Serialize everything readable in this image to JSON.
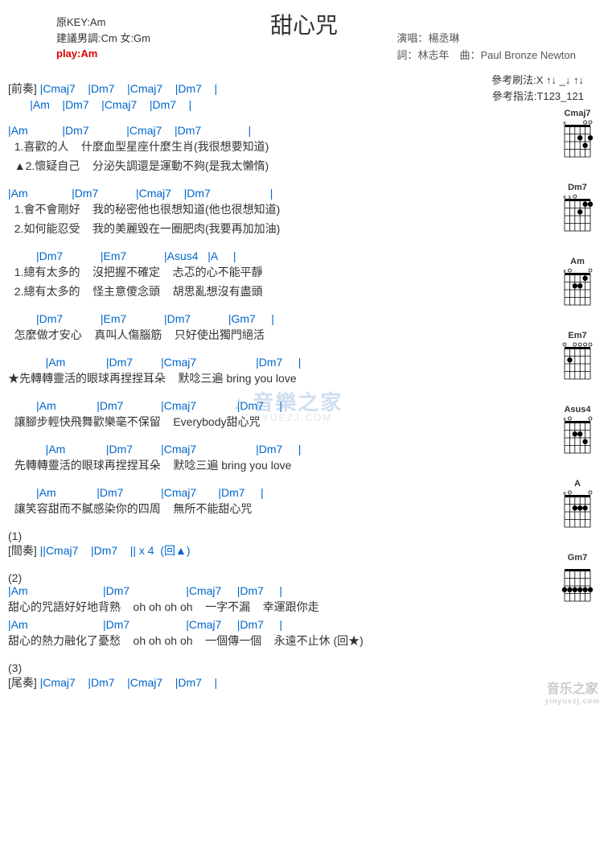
{
  "header": {
    "original_key": "原KEY:Am",
    "suggested": "建議男調:Cm 女:Gm",
    "play": "play:Am",
    "title": "甜心咒",
    "singer_label": "演唱：",
    "singer": "楊丞琳",
    "lyricist_label": "詞：",
    "lyricist": "林志年",
    "composer_label": "曲：",
    "composer": "Paul Bronze Newton",
    "strum_label": "參考刷法:",
    "strum": "X ↑↓ _↓ ↑↓",
    "pick_label": "參考指法:",
    "pick": "T123_121"
  },
  "sections": {
    "intro_label": "[前奏]",
    "intro_chords1": "|Cmaj7    |Dm7    |Cmaj7    |Dm7    |",
    "intro_chords2": "|Am    |Dm7    |Cmaj7    |Dm7    |",
    "v_chords1": "|Am           |Dm7            |Cmaj7    |Dm7               |",
    "v1_line1": "  1.喜歡的人    什麼血型星座什麼生肖(我很想要知道)",
    "v2_line1": "  ▲2.懷疑自己    分泌失調還是運動不夠(是我太懶惰)",
    "v_chords2": "|Am              |Dm7            |Cmaj7    |Dm7                   |",
    "v1_line2": "  1.會不會剛好    我的秘密他也很想知道(他也很想知道)",
    "v2_line2": "  2.如何能忍受    我的美麗毀在一圈肥肉(我要再加加油)",
    "pc_chords1": "         |Dm7            |Em7            |Asus4   |A     |",
    "pc1_line1": "  1.總有太多的    沒把握不確定    忐忑的心不能平靜",
    "pc2_line1": "  2.總有太多的    怪主意傻念頭    胡思亂想沒有盡頭",
    "pc_chords2": "         |Dm7            |Em7            |Dm7            |Gm7     |",
    "pc_line2": "  怎麼做才安心    真叫人傷腦筋    只好使出獨門絕活",
    "ch_chords1": "            |Am             |Dm7         |Cmaj7                   |Dm7     |",
    "ch_line1": "★先轉轉靈活的眼球再捏捏耳朵    默唸三遍 bring you love",
    "ch_chords2": "         |Am             |Dm7            |Cmaj7             |Dm7     |",
    "ch_line2": "  讓腳步輕快飛舞歡樂毫不保留    Everybody甜心咒",
    "ch_chords3": "            |Am             |Dm7         |Cmaj7                   |Dm7     |",
    "ch_line3": "  先轉轉靈活的眼球再捏捏耳朵    默唸三遍 bring you love",
    "ch_chords4": "         |Am             |Dm7            |Cmaj7       |Dm7     |",
    "ch_line4": "  讓笑容甜而不膩感染你的四周    無所不能甜心咒",
    "mark1": "(1)",
    "inter_label": "[間奏]",
    "inter_chords": " ||Cmaj7    |Dm7    || x 4  (回▲)",
    "mark2": "(2)",
    "br_chords1": "|Am                        |Dm7                  |Cmaj7     |Dm7     |",
    "br_line1": "甜心的咒語好好地背熟    oh oh oh oh    一字不漏    幸運跟你走",
    "br_chords2": "|Am                        |Dm7                  |Cmaj7     |Dm7     |",
    "br_line2": "甜心的熱力融化了憂愁    oh oh oh oh    一個傳一個    永遠不止休 (回★)",
    "mark3": "(3)",
    "outro_label": "[尾奏]",
    "outro_chords": " |Cmaj7    |Dm7    |Cmaj7    |Dm7    |"
  },
  "diagrams": [
    {
      "name": "Cmaj7",
      "dots": [
        [
          2,
          1
        ],
        [
          3,
          2
        ],
        [
          2,
          3
        ]
      ],
      "open": [
        1,
        2
      ],
      "mute": [
        6
      ]
    },
    {
      "name": "Dm7",
      "dots": [
        [
          1,
          1
        ],
        [
          1,
          2
        ],
        [
          2,
          3
        ]
      ],
      "open": [
        4
      ],
      "mute": [
        5,
        6
      ]
    },
    {
      "name": "Am",
      "dots": [
        [
          1,
          2
        ],
        [
          2,
          3
        ],
        [
          2,
          4
        ]
      ],
      "open": [
        1,
        5
      ],
      "mute": [
        6
      ]
    },
    {
      "name": "Em7",
      "dots": [
        [
          2,
          5
        ]
      ],
      "open": [
        1,
        2,
        3,
        4,
        6
      ],
      "mute": []
    },
    {
      "name": "Asus4",
      "dots": [
        [
          2,
          4
        ],
        [
          2,
          3
        ],
        [
          3,
          2
        ]
      ],
      "open": [
        1,
        5
      ],
      "mute": [
        6
      ]
    },
    {
      "name": "A",
      "dots": [
        [
          2,
          2
        ],
        [
          2,
          3
        ],
        [
          2,
          4
        ]
      ],
      "open": [
        1,
        5
      ],
      "mute": [
        6
      ]
    },
    {
      "name": "Gm7",
      "dots": [
        [
          3,
          1
        ],
        [
          3,
          2
        ],
        [
          3,
          3
        ],
        [
          3,
          4
        ],
        [
          3,
          5
        ],
        [
          3,
          6
        ]
      ],
      "open": [],
      "mute": []
    }
  ],
  "watermark": {
    "main": "♪ 音樂之家",
    "sub": "YINYUEZJ.COM",
    "bottom": "音乐之家",
    "bottom_sub": "yinyuezj.com"
  }
}
